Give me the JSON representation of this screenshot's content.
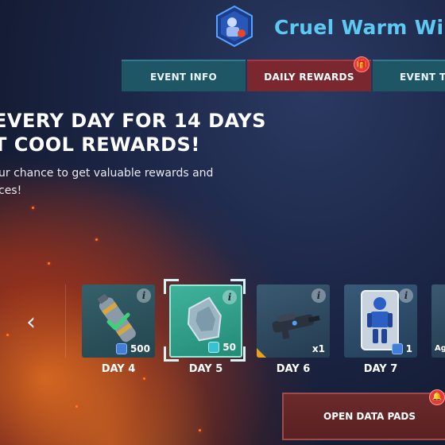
{
  "header": {
    "event_title": "Cruel Warm Win"
  },
  "tabs": [
    {
      "label": "EVENT INFO"
    },
    {
      "label": "DAILY REWARDS"
    },
    {
      "label": "EVENT TA"
    }
  ],
  "headline": {
    "line1": "EVERY DAY FOR 14 DAYS",
    "line2": "T COOL REWARDS!"
  },
  "subtext": {
    "line1": "ur chance to get valuable rewards and",
    "line2": "ces!"
  },
  "days": [
    {
      "label": "DAY 4",
      "qty": "500",
      "claimed": true
    },
    {
      "label": "DAY 5",
      "qty": "50",
      "selected": true
    },
    {
      "label": "DAY 6",
      "qty": "x1"
    },
    {
      "label": "DAY 7",
      "qty": "1"
    },
    {
      "label": "",
      "qty": "Ag"
    }
  ],
  "open_button": {
    "label": "OPEN DATA PADS"
  },
  "colors": {
    "accent_title": "#5cc9f2",
    "tab_active": "#7a2730",
    "tab_inactive": "#1f5666",
    "claimed_check": "#3fd07a"
  }
}
